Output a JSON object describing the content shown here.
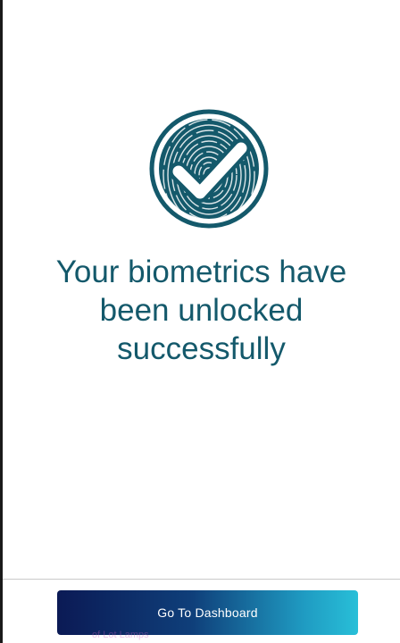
{
  "badge": {
    "icon": "fingerprint-check-icon",
    "color": "#14596b"
  },
  "message": {
    "line1": "Your biometrics have",
    "line2": "been unlocked",
    "line3": "successfully",
    "color": "#14596b"
  },
  "actions": {
    "dashboard_label": "Go To Dashboard",
    "gradient_colors": [
      "#0b1a55",
      "#0f3f7a",
      "#1f9bc2",
      "#28bfd8"
    ]
  },
  "footer": {
    "faint_text": "of Lot Lamps"
  }
}
